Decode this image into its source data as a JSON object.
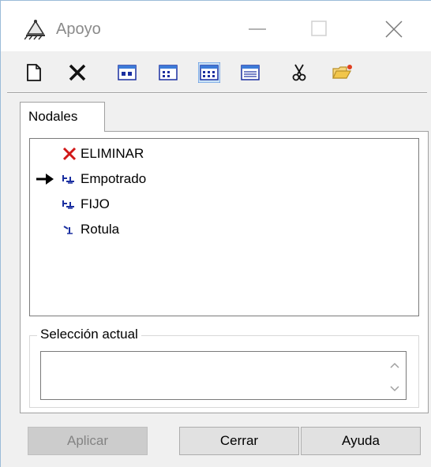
{
  "window": {
    "title": "Apoyo"
  },
  "toolbar": {
    "items": [
      {
        "icon": "new-document-icon"
      },
      {
        "icon": "delete-x-icon"
      },
      {
        "icon": "view-large-icons-icon"
      },
      {
        "icon": "view-small-icons-icon"
      },
      {
        "icon": "view-list-icon"
      },
      {
        "icon": "view-details-icon"
      },
      {
        "icon": "scissors-icon"
      },
      {
        "icon": "open-folder-icon"
      }
    ]
  },
  "tabs": [
    {
      "label": "Nodales",
      "active": true
    }
  ],
  "list": {
    "items": [
      {
        "label": "ELIMINAR",
        "icon": "red-x-icon",
        "selected": false
      },
      {
        "label": "Empotrado",
        "icon": "fixed-support-icon",
        "selected": true
      },
      {
        "label": "FIJO",
        "icon": "fixed-support-icon",
        "selected": false
      },
      {
        "label": "Rotula",
        "icon": "hinge-support-icon",
        "selected": false
      }
    ]
  },
  "current_selection": {
    "label": "Selección actual",
    "value": ""
  },
  "buttons": {
    "apply": "Aplicar",
    "close": "Cerrar",
    "help": "Ayuda"
  },
  "colors": {
    "accent_blue": "#1a2fa0",
    "delete_red": "#d11818",
    "folder_yellow": "#f2c64b"
  }
}
